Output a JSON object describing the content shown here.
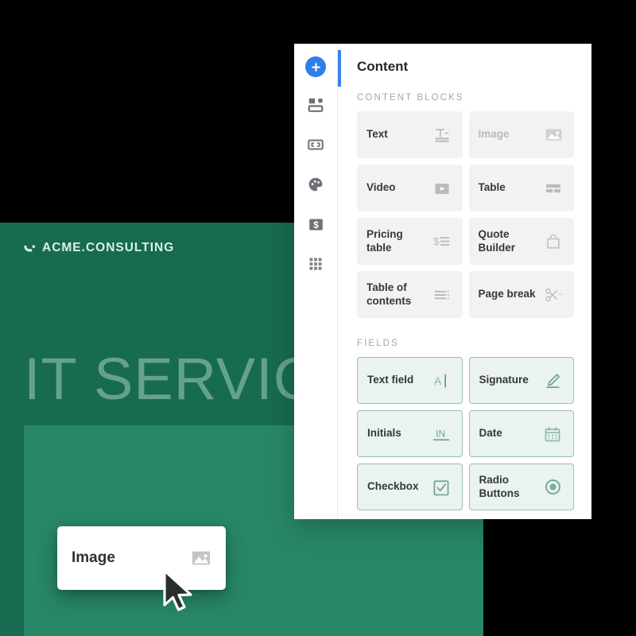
{
  "document": {
    "logo_text": "ACME.CONSULTING",
    "logo_mark": "crescent-swoosh-icon",
    "title": "IT SERVIC",
    "colors": {
      "cover": "#176b50",
      "inner_panel": "#288766",
      "logo_text": "#d9efe6",
      "title_text": "rgba(220,245,234,0.40)"
    }
  },
  "drag_card": {
    "label": "Image",
    "icon": "image-icon",
    "cursor": "mouse-pointer-icon"
  },
  "panel": {
    "title": "Content",
    "accent_color": "#3b82e8",
    "rail": {
      "items": [
        {
          "icon": "plus-icon",
          "name": "add-block-button",
          "active": true
        },
        {
          "icon": "layout-blocks-icon",
          "name": "rail-item-layout"
        },
        {
          "icon": "brackets-icon",
          "name": "rail-item-variables"
        },
        {
          "icon": "palette-icon",
          "name": "rail-item-theme"
        },
        {
          "icon": "dollar-icon",
          "name": "rail-item-pricing"
        },
        {
          "icon": "grid-dots-icon",
          "name": "rail-item-apps"
        }
      ]
    },
    "sections": [
      {
        "label": "CONTENT BLOCKS",
        "kind": "block",
        "items": [
          {
            "label": "Text",
            "icon": "text-icon",
            "disabled": false
          },
          {
            "label": "Image",
            "icon": "image-icon",
            "disabled": true
          },
          {
            "label": "Video",
            "icon": "video-play-icon",
            "disabled": false
          },
          {
            "label": "Table",
            "icon": "table-icon",
            "disabled": false
          },
          {
            "label": "Pricing table",
            "icon": "pricing-icon",
            "disabled": false
          },
          {
            "label": "Quote Builder",
            "icon": "shopping-bag-icon",
            "disabled": false
          },
          {
            "label": "Table of contents",
            "icon": "toc-icon",
            "disabled": false
          },
          {
            "label": "Page break",
            "icon": "scissors-icon",
            "disabled": false
          }
        ]
      },
      {
        "label": "FIELDS",
        "kind": "field",
        "items": [
          {
            "label": "Text field",
            "icon": "text-cursor-icon"
          },
          {
            "label": "Signature",
            "icon": "pen-signature-icon"
          },
          {
            "label": "Initials",
            "icon": "initials-icon"
          },
          {
            "label": "Date",
            "icon": "calendar-icon"
          },
          {
            "label": "Checkbox",
            "icon": "checkbox-icon"
          },
          {
            "label": "Radio Buttons",
            "icon": "radio-button-icon"
          }
        ]
      }
    ]
  }
}
